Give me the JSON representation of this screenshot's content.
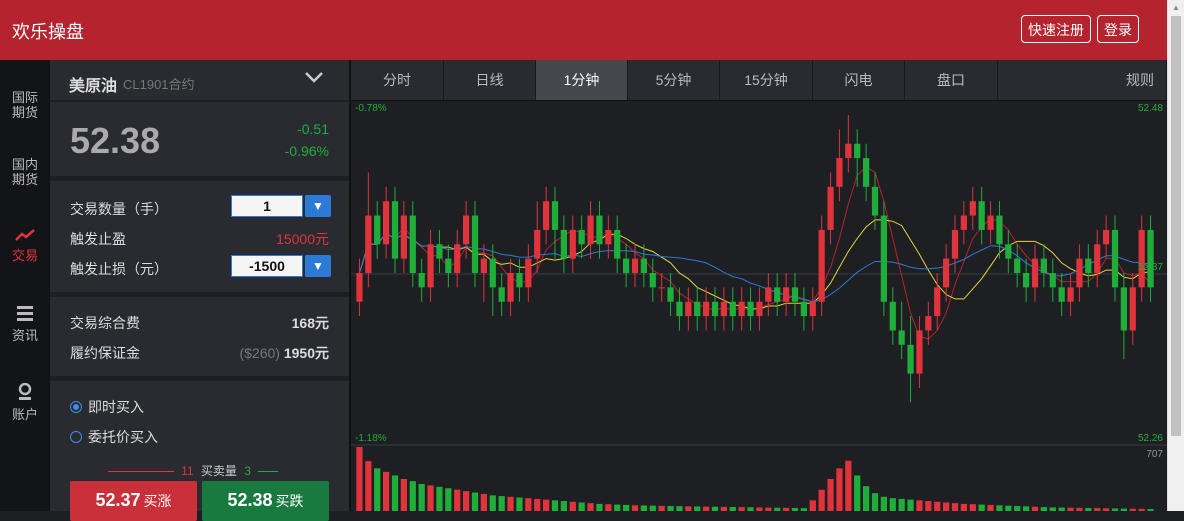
{
  "header": {
    "title": "欢乐操盘",
    "register": "快速注册",
    "login": "登录"
  },
  "nav": [
    {
      "label1": "国际",
      "label2": "期货",
      "icon": ""
    },
    {
      "label1": "国内",
      "label2": "期货",
      "icon": ""
    },
    {
      "label1": "交易",
      "label2": "",
      "icon": "trend-icon"
    },
    {
      "label1": "资讯",
      "label2": "",
      "icon": "list-icon"
    },
    {
      "label1": "账户",
      "label2": "",
      "icon": "user-icon"
    }
  ],
  "product": {
    "name": "美原油",
    "code": "CL1901合约"
  },
  "quote": {
    "price": "52.38",
    "change": "-0.51",
    "change_pct": "-0.96%"
  },
  "order": {
    "qty_label": "交易数量（手）",
    "qty_value": "1",
    "tp_label": "触发止盈",
    "tp_value": "15000元",
    "sl_label": "触发止损（元）",
    "sl_value": "-1500",
    "fee_label": "交易综合费",
    "fee_value": "168元",
    "margin_label": "履约保证金",
    "margin_usd": "($260)",
    "margin_value": "1950元"
  },
  "order_type": {
    "market": "即时买入",
    "limit": "委托价买入"
  },
  "depth": {
    "buy_qty": "11",
    "label": "买卖量",
    "sell_qty": "3"
  },
  "buttons": {
    "up_price": "52.37",
    "up_label": "买涨",
    "down_price": "52.38",
    "down_label": "买跌"
  },
  "tabs": [
    "分时",
    "日线",
    "1分钟",
    "5分钟",
    "15分钟",
    "闪电",
    "盘口",
    "规则"
  ],
  "active_tab": "1分钟",
  "chart_labels": {
    "pct_top": "-0.78%",
    "pct_bottom": "-1.18%",
    "price_top": "52.48",
    "price_mid": "52.37",
    "price_bottom": "52.26",
    "vol_max": "707"
  },
  "colors": {
    "up": "#e0333c",
    "down": "#1fae3a",
    "brand": "#b5232e",
    "accent": "#2b7ad6"
  },
  "chart_data": {
    "type": "candlestick",
    "ylim": [
      52.26,
      52.48
    ],
    "candles": [
      [
        52.35,
        52.37,
        52.38,
        52.34
      ],
      [
        52.37,
        52.41,
        52.44,
        52.36
      ],
      [
        52.41,
        52.39,
        52.42,
        52.38
      ],
      [
        52.39,
        52.42,
        52.43,
        52.38
      ],
      [
        52.42,
        52.38,
        52.43,
        52.37
      ],
      [
        52.38,
        52.41,
        52.42,
        52.37
      ],
      [
        52.41,
        52.37,
        52.42,
        52.36
      ],
      [
        52.37,
        52.36,
        52.38,
        52.35
      ],
      [
        52.36,
        52.39,
        52.4,
        52.35
      ],
      [
        52.39,
        52.38,
        52.4,
        52.37
      ],
      [
        52.38,
        52.37,
        52.39,
        52.36
      ],
      [
        52.37,
        52.39,
        52.4,
        52.36
      ],
      [
        52.39,
        52.41,
        52.42,
        52.38
      ],
      [
        52.41,
        52.37,
        52.42,
        52.36
      ],
      [
        52.37,
        52.38,
        52.39,
        52.35
      ],
      [
        52.38,
        52.36,
        52.39,
        52.34
      ],
      [
        52.36,
        52.35,
        52.37,
        52.34
      ],
      [
        52.35,
        52.37,
        52.38,
        52.34
      ],
      [
        52.37,
        52.36,
        52.38,
        52.35
      ],
      [
        52.36,
        52.38,
        52.39,
        52.35
      ],
      [
        52.38,
        52.4,
        52.42,
        52.37
      ],
      [
        52.4,
        52.42,
        52.43,
        52.39
      ],
      [
        52.42,
        52.4,
        52.43,
        52.38
      ],
      [
        52.4,
        52.38,
        52.41,
        52.37
      ],
      [
        52.38,
        52.4,
        52.41,
        52.37
      ],
      [
        52.4,
        52.39,
        52.41,
        52.38
      ],
      [
        52.39,
        52.41,
        52.42,
        52.38
      ],
      [
        52.41,
        52.39,
        52.42,
        52.38
      ],
      [
        52.39,
        52.4,
        52.41,
        52.38
      ],
      [
        52.4,
        52.38,
        52.41,
        52.37
      ],
      [
        52.38,
        52.37,
        52.39,
        52.36
      ],
      [
        52.37,
        52.38,
        52.39,
        52.36
      ],
      [
        52.38,
        52.37,
        52.39,
        52.36
      ],
      [
        52.37,
        52.36,
        52.38,
        52.35
      ],
      [
        52.36,
        52.36,
        52.37,
        52.35
      ],
      [
        52.36,
        52.35,
        52.37,
        52.34
      ],
      [
        52.35,
        52.34,
        52.36,
        52.33
      ],
      [
        52.34,
        52.35,
        52.36,
        52.33
      ],
      [
        52.35,
        52.34,
        52.36,
        52.33
      ],
      [
        52.34,
        52.35,
        52.36,
        52.33
      ],
      [
        52.35,
        52.34,
        52.36,
        52.33
      ],
      [
        52.34,
        52.35,
        52.36,
        52.33
      ],
      [
        52.35,
        52.34,
        52.36,
        52.33
      ],
      [
        52.34,
        52.35,
        52.36,
        52.33
      ],
      [
        52.35,
        52.34,
        52.36,
        52.33
      ],
      [
        52.34,
        52.35,
        52.36,
        52.33
      ],
      [
        52.35,
        52.36,
        52.37,
        52.34
      ],
      [
        52.36,
        52.35,
        52.37,
        52.34
      ],
      [
        52.35,
        52.36,
        52.37,
        52.34
      ],
      [
        52.36,
        52.35,
        52.37,
        52.34
      ],
      [
        52.35,
        52.34,
        52.36,
        52.33
      ],
      [
        52.34,
        52.35,
        52.36,
        52.33
      ],
      [
        52.35,
        52.4,
        52.41,
        52.34
      ],
      [
        52.4,
        52.43,
        52.44,
        52.39
      ],
      [
        52.43,
        52.45,
        52.47,
        52.42
      ],
      [
        52.45,
        52.46,
        52.48,
        52.44
      ],
      [
        52.46,
        52.45,
        52.47,
        52.43
      ],
      [
        52.45,
        52.43,
        52.46,
        52.42
      ],
      [
        52.43,
        52.41,
        52.44,
        52.4
      ],
      [
        52.41,
        52.35,
        52.42,
        52.34
      ],
      [
        52.35,
        52.33,
        52.36,
        52.32
      ],
      [
        52.33,
        52.32,
        52.35,
        52.31
      ],
      [
        52.32,
        52.3,
        52.34,
        52.28
      ],
      [
        52.3,
        52.33,
        52.34,
        52.29
      ],
      [
        52.33,
        52.34,
        52.35,
        52.32
      ],
      [
        52.34,
        52.36,
        52.37,
        52.33
      ],
      [
        52.36,
        52.38,
        52.39,
        52.35
      ],
      [
        52.38,
        52.4,
        52.41,
        52.37
      ],
      [
        52.4,
        52.41,
        52.42,
        52.39
      ],
      [
        52.41,
        52.42,
        52.43,
        52.4
      ],
      [
        52.42,
        52.4,
        52.43,
        52.39
      ],
      [
        52.4,
        52.41,
        52.42,
        52.39
      ],
      [
        52.41,
        52.39,
        52.42,
        52.38
      ],
      [
        52.39,
        52.38,
        52.4,
        52.37
      ],
      [
        52.38,
        52.37,
        52.39,
        52.36
      ],
      [
        52.37,
        52.36,
        52.38,
        52.35
      ],
      [
        52.36,
        52.38,
        52.39,
        52.35
      ],
      [
        52.38,
        52.37,
        52.39,
        52.36
      ],
      [
        52.37,
        52.36,
        52.38,
        52.35
      ],
      [
        52.36,
        52.35,
        52.37,
        52.34
      ],
      [
        52.35,
        52.36,
        52.37,
        52.34
      ],
      [
        52.36,
        52.38,
        52.39,
        52.35
      ],
      [
        52.38,
        52.37,
        52.39,
        52.36
      ],
      [
        52.37,
        52.39,
        52.4,
        52.36
      ],
      [
        52.39,
        52.4,
        52.41,
        52.38
      ],
      [
        52.4,
        52.36,
        52.41,
        52.35
      ],
      [
        52.36,
        52.33,
        52.37,
        52.31
      ],
      [
        52.33,
        52.36,
        52.37,
        52.32
      ],
      [
        52.36,
        52.4,
        52.41,
        52.35
      ],
      [
        52.4,
        52.36,
        52.41,
        52.35
      ]
    ],
    "volume": [
      900,
      700,
      600,
      550,
      500,
      450,
      420,
      380,
      360,
      340,
      320,
      300,
      280,
      260,
      240,
      220,
      210,
      200,
      190,
      180,
      170,
      160,
      150,
      140,
      130,
      120,
      110,
      100,
      95,
      90,
      85,
      80,
      78,
      75,
      72,
      70,
      68,
      66,
      64,
      62,
      60,
      58,
      56,
      54,
      52,
      50,
      48,
      46,
      44,
      42,
      40,
      150,
      300,
      450,
      600,
      707,
      500,
      350,
      250,
      200,
      180,
      170,
      160,
      150,
      140,
      130,
      120,
      110,
      100,
      95,
      90,
      85,
      80,
      75,
      70,
      65,
      60,
      55,
      50,
      48,
      46,
      44,
      42,
      40,
      38,
      36,
      34,
      32,
      30,
      28
    ]
  }
}
